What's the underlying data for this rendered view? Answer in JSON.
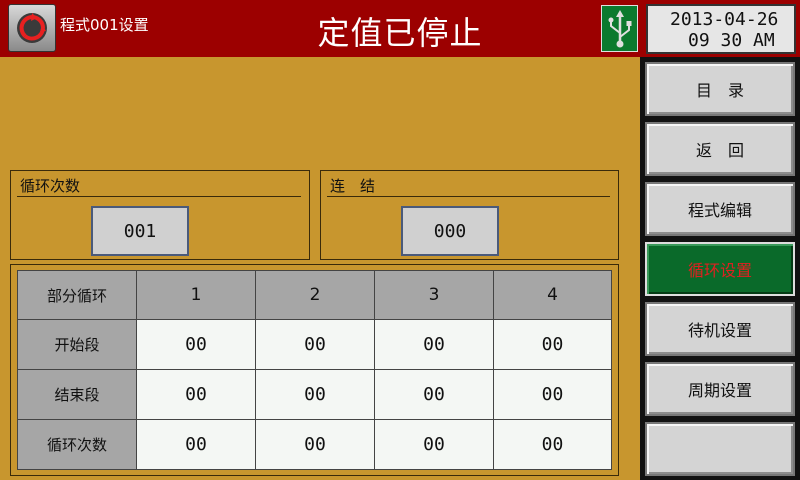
{
  "header": {
    "program_title": "程式001设置",
    "status_title": "定值已停止",
    "date": "2013-04-26",
    "time": "09 30 AM"
  },
  "icons": {
    "logo": "recycle-logo-icon",
    "usb": "usb-icon"
  },
  "colors": {
    "header_bg": "#9c0000",
    "panel_bg": "#c8962e",
    "active_button_bg": "#0a6a2a",
    "active_button_text": "#e02020"
  },
  "loop_count": {
    "label": "循环次数",
    "value": "001"
  },
  "link": {
    "label": "连　结",
    "value": "000"
  },
  "table": {
    "corner": "部分循环",
    "columns": [
      "1",
      "2",
      "3",
      "4"
    ],
    "rows": [
      {
        "label": "开始段",
        "values": [
          "00",
          "00",
          "00",
          "00"
        ]
      },
      {
        "label": "结束段",
        "values": [
          "00",
          "00",
          "00",
          "00"
        ]
      },
      {
        "label": "循环次数",
        "values": [
          "00",
          "00",
          "00",
          "00"
        ]
      }
    ]
  },
  "sidebar": {
    "items": [
      {
        "label": "目　录"
      },
      {
        "label": "返　回"
      },
      {
        "label": "程式编辑"
      },
      {
        "label": "循环设置"
      },
      {
        "label": "待机设置"
      },
      {
        "label": "周期设置"
      },
      {
        "label": ""
      }
    ]
  }
}
